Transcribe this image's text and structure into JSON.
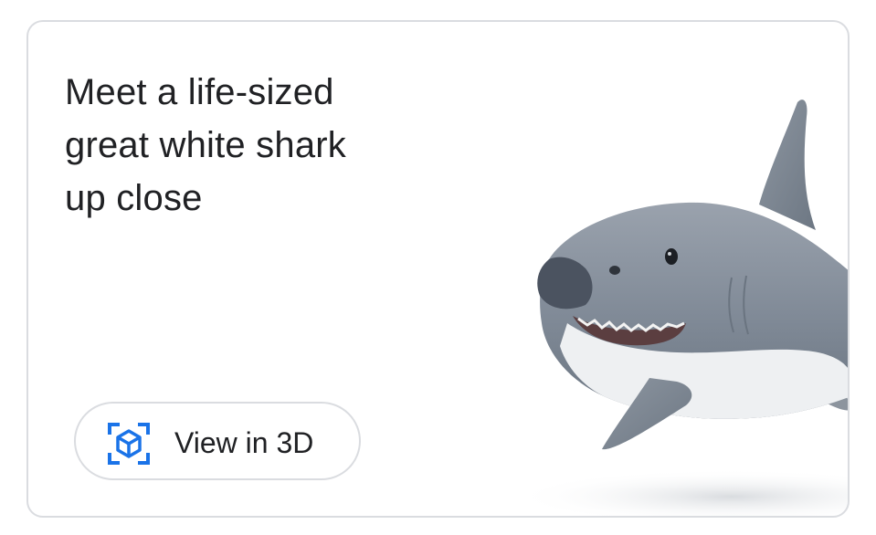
{
  "card": {
    "title_lines": [
      "Meet a life-sized",
      "great white shark",
      "up close"
    ]
  },
  "view_button": {
    "label": "View in 3D",
    "icon": "3d-cube-icon",
    "accent": "#1a73e8"
  },
  "image": {
    "subject": "great-white-shark-icon"
  }
}
